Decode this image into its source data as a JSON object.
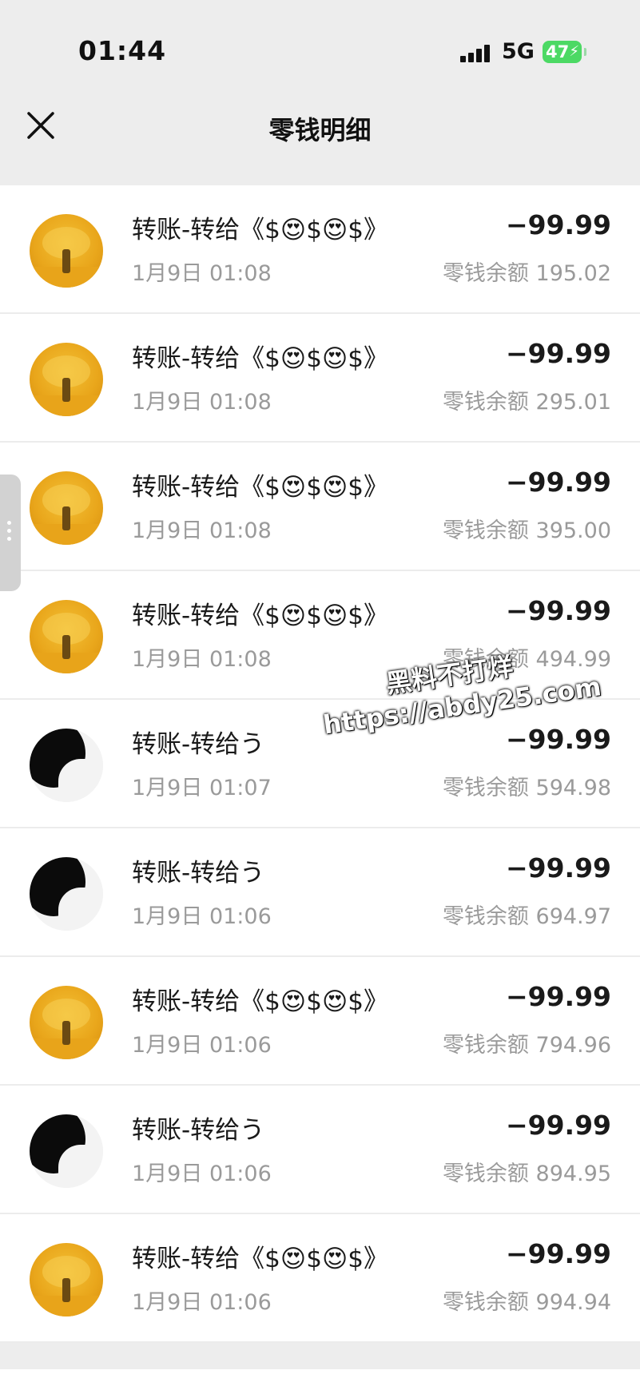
{
  "status_bar": {
    "time": "01:44",
    "network": "5G",
    "battery": "47"
  },
  "header": {
    "title": "零钱明细"
  },
  "transactions": [
    {
      "avatar": "gold-tree",
      "title": "转账-转给《$😍$😍$》",
      "time": "1月9日 01:08",
      "amount": "−99.99",
      "balance": "零钱余额 195.02"
    },
    {
      "avatar": "gold-tree",
      "title": "转账-转给《$😍$😍$》",
      "time": "1月9日 01:08",
      "amount": "−99.99",
      "balance": "零钱余额 295.01"
    },
    {
      "avatar": "gold-tree",
      "title": "转账-转给《$😍$😍$》",
      "time": "1月9日 01:08",
      "amount": "−99.99",
      "balance": "零钱余额 395.00"
    },
    {
      "avatar": "gold-tree",
      "title": "转账-转给《$😍$😍$》",
      "time": "1月9日 01:08",
      "amount": "−99.99",
      "balance": "零钱余额 494.99"
    },
    {
      "avatar": "black-white",
      "title": "转账-转给う",
      "time": "1月9日 01:07",
      "amount": "−99.99",
      "balance": "零钱余额 594.98"
    },
    {
      "avatar": "black-white",
      "title": "转账-转给う",
      "time": "1月9日 01:06",
      "amount": "−99.99",
      "balance": "零钱余额 694.97"
    },
    {
      "avatar": "gold-tree",
      "title": "转账-转给《$😍$😍$》",
      "time": "1月9日 01:06",
      "amount": "−99.99",
      "balance": "零钱余额 794.96"
    },
    {
      "avatar": "black-white",
      "title": "转账-转给う",
      "time": "1月9日 01:06",
      "amount": "−99.99",
      "balance": "零钱余额 894.95"
    },
    {
      "avatar": "gold-tree",
      "title": "转账-转给《$😍$😍$》",
      "time": "1月9日 01:06",
      "amount": "−99.99",
      "balance": "零钱余额 994.94"
    }
  ],
  "watermark": {
    "line1": "黑料不打烊",
    "line2": "https://abdy25.com"
  },
  "icons": {
    "close": "close-icon",
    "signal": "signal-icon",
    "battery": "battery-icon",
    "side_handle": "more-vertical-icon"
  }
}
